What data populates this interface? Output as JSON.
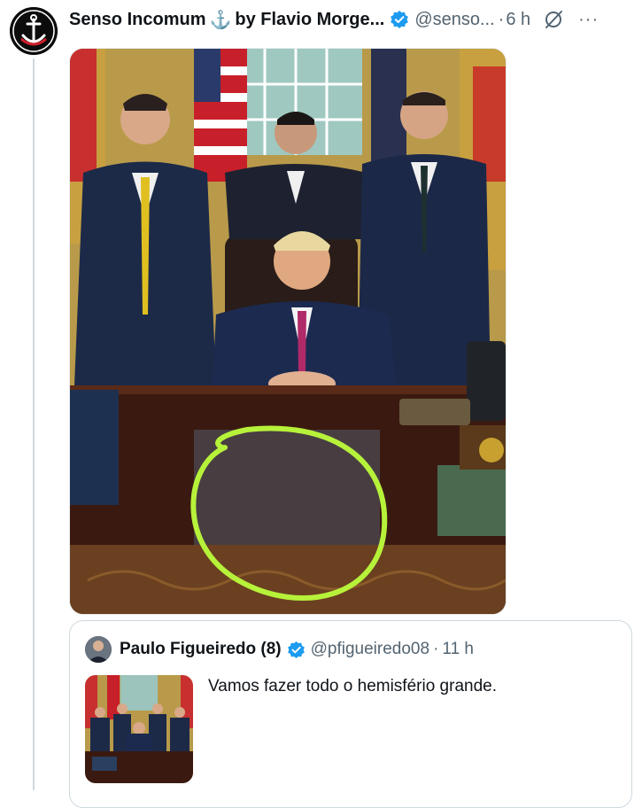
{
  "tweet": {
    "author_name": "Senso Incomum",
    "anchor_emoji": "⚓",
    "author_name_suffix": "by Flavio Morge...",
    "handle": "@senso...",
    "separator": "·",
    "time": "6 h",
    "more_label": "···",
    "icons": [
      "verified-badge-icon",
      "grok-icon",
      "more-icon"
    ],
    "media": {
      "alt": "photo"
    }
  },
  "quote": {
    "author_name": "Paulo Figueiredo (8)",
    "handle": "@pfigueiredo08",
    "separator": "·",
    "time": "11 h",
    "text": "Vamos fazer todo o hemisfério grande."
  },
  "colors": {
    "verified": "#1d9bf0",
    "secondary_text": "#536471",
    "highlight_circle": "#b7f23a"
  }
}
